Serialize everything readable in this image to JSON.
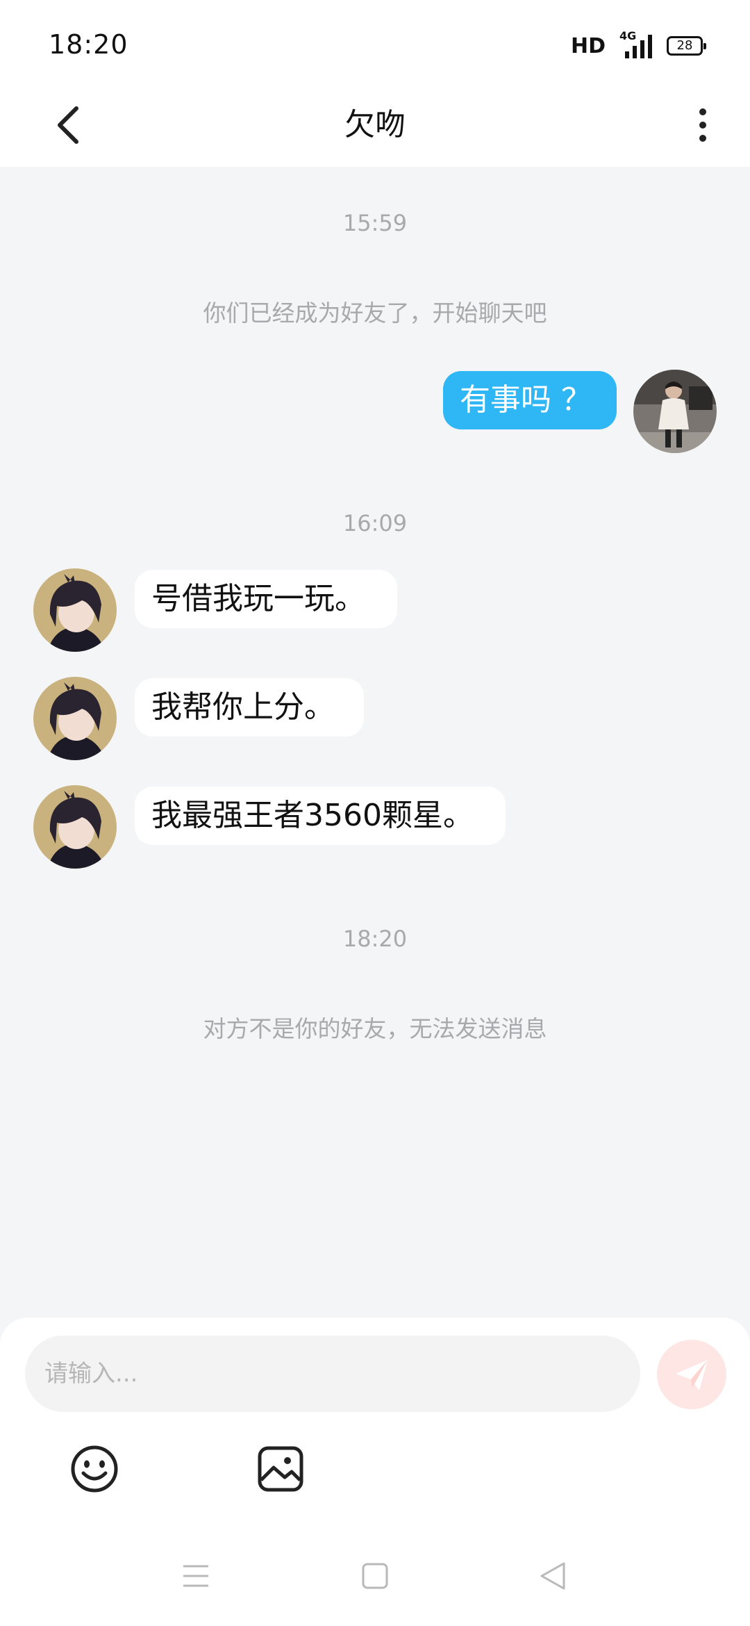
{
  "status_bar": {
    "time": "18:20",
    "hd": "HD",
    "network": "4G",
    "battery": "28"
  },
  "header": {
    "title": "欠吻",
    "back_icon": "chevron-left-icon",
    "more_icon": "more-vertical-icon"
  },
  "messages": {
    "time1": "15:59",
    "system1": "你们已经成为好友了，开始聊天吧",
    "outgoing1": "有事吗 ？",
    "time2": "16:09",
    "incoming1": "号借我玩一玩。",
    "incoming2": "我帮你上分。",
    "incoming3": "我最强王者3560颗星。",
    "time3": "18:20",
    "system2": "对方不是你的好友，无法发送消息"
  },
  "input": {
    "placeholder": "请输入...",
    "send_icon": "send-icon",
    "emoji_icon": "emoji-icon",
    "image_icon": "image-icon"
  },
  "colors": {
    "outgoing_bubble": "#2eb6f5",
    "background": "#f4f5f7",
    "send_disabled": "#fde6e4"
  }
}
